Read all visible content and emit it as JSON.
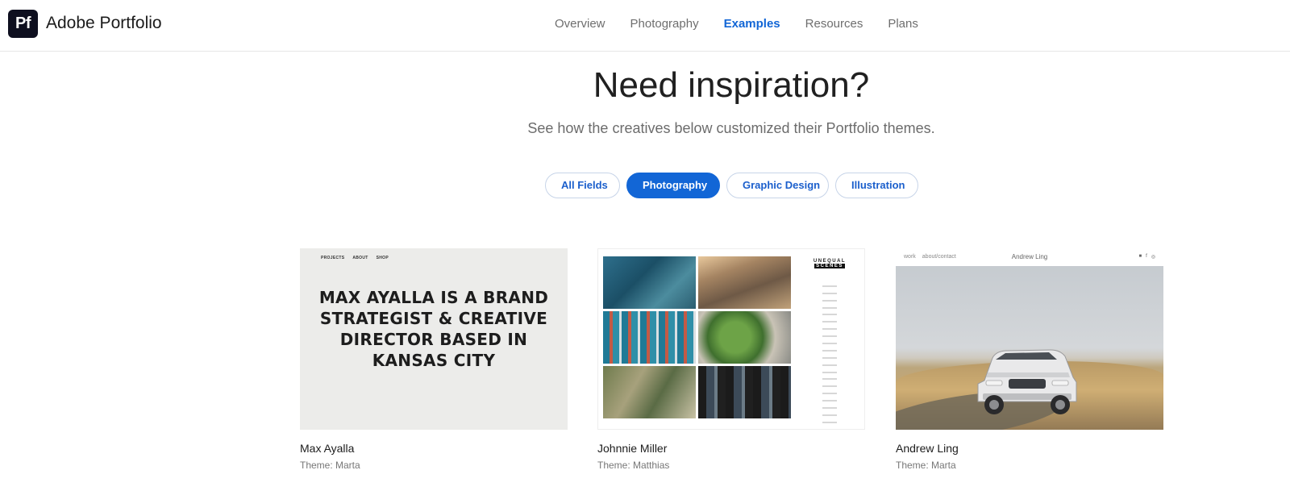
{
  "header": {
    "logo_text": "Pf",
    "brand": "Adobe Portfolio",
    "nav": [
      {
        "label": "Overview",
        "active": false
      },
      {
        "label": "Photography",
        "active": false
      },
      {
        "label": "Examples",
        "active": true
      },
      {
        "label": "Resources",
        "active": false
      },
      {
        "label": "Plans",
        "active": false
      }
    ]
  },
  "hero": {
    "title": "Need inspiration?",
    "subtitle": "See how the creatives below customized their Portfolio themes."
  },
  "filters": [
    {
      "label": "All Fields",
      "active": false
    },
    {
      "label": "Photography",
      "active": true
    },
    {
      "label": "Graphic Design",
      "active": false
    },
    {
      "label": "Illustration",
      "active": false
    }
  ],
  "cards": [
    {
      "name": "Max Ayalla",
      "theme": "Theme: Marta",
      "thumb": {
        "nav": [
          "PROJECTS",
          "ABOUT",
          "SHOP"
        ],
        "headline": "MAX AYALLA IS A BRAND STRATEGIST & CREATIVE DIRECTOR BASED IN KANSAS CITY"
      }
    },
    {
      "name": "Johnnie Miller",
      "theme": "Theme: Matthias",
      "thumb": {
        "logo_a": "UNEQUAL",
        "logo_b": "SCENES"
      }
    },
    {
      "name": "Andrew Ling",
      "theme": "Theme: Marta",
      "thumb": {
        "links": [
          "work",
          "about/contact"
        ],
        "title": "Andrew Ling"
      }
    }
  ],
  "colors": {
    "accent": "#1266d6",
    "logo_bg": "#0e0f1f"
  }
}
